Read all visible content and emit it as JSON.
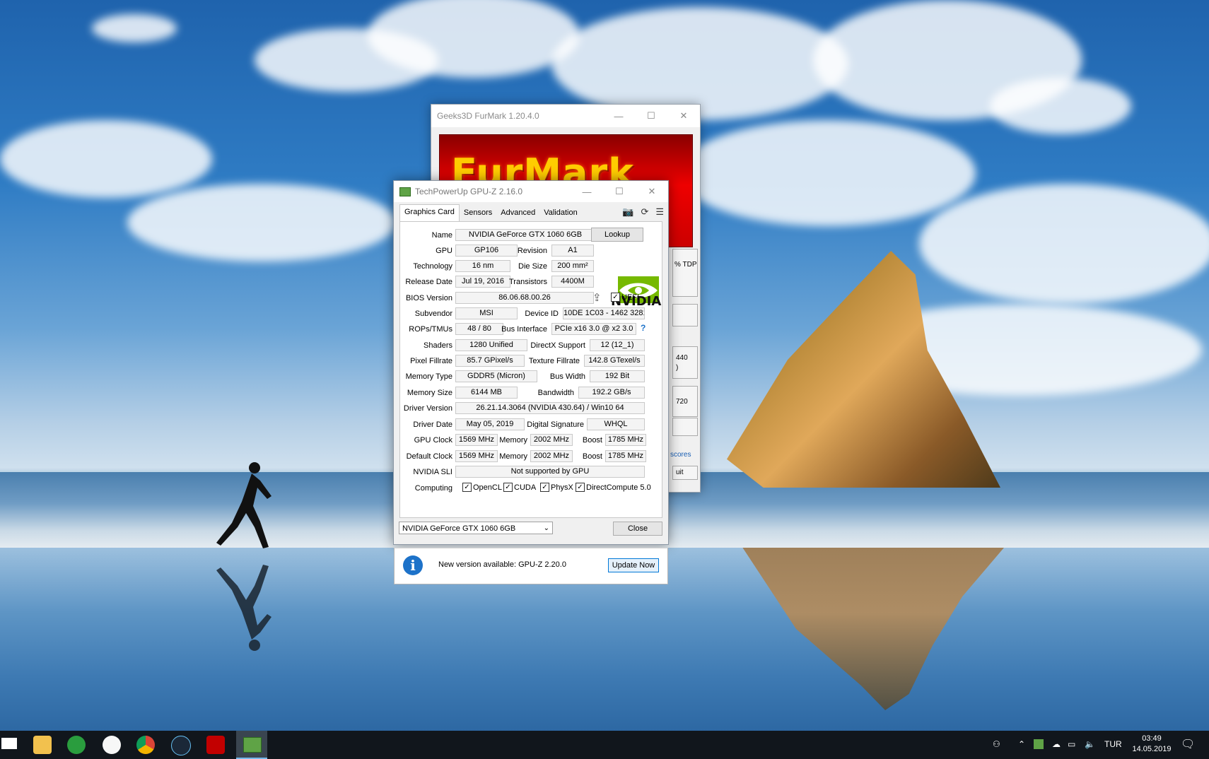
{
  "furmark": {
    "title": "Geeks3D FurMark 1.20.4.0",
    "banner": "FurMark",
    "side_texts": [
      "% TDP",
      "440",
      ")",
      "720",
      "scores",
      "uit"
    ]
  },
  "gpuz": {
    "title": "TechPowerUp GPU-Z 2.16.0",
    "tabs": [
      "Graphics Card",
      "Sensors",
      "Advanced",
      "Validation"
    ],
    "labels": {
      "name": "Name",
      "gpu": "GPU",
      "revision": "Revision",
      "technology": "Technology",
      "die_size": "Die Size",
      "release_date": "Release Date",
      "transistors": "Transistors",
      "bios_version": "BIOS Version",
      "subvendor": "Subvendor",
      "device_id": "Device ID",
      "rops_tmus": "ROPs/TMUs",
      "bus_interface": "Bus Interface",
      "shaders": "Shaders",
      "directx": "DirectX Support",
      "pixel_fillrate": "Pixel Fillrate",
      "texture_fillrate": "Texture Fillrate",
      "memory_type": "Memory Type",
      "bus_width": "Bus Width",
      "memory_size": "Memory Size",
      "bandwidth": "Bandwidth",
      "driver_version": "Driver Version",
      "driver_date": "Driver Date",
      "digital_signature": "Digital Signature",
      "gpu_clock": "GPU Clock",
      "memory": "Memory",
      "boost": "Boost",
      "default_clock": "Default Clock",
      "nvidia_sli": "NVIDIA SLI",
      "computing": "Computing"
    },
    "values": {
      "name": "NVIDIA GeForce GTX 1060 6GB",
      "gpu": "GP106",
      "revision": "A1",
      "technology": "16 nm",
      "die_size": "200 mm²",
      "release_date": "Jul 19, 2016",
      "transistors": "4400M",
      "bios_version": "86.06.68.00.26",
      "subvendor": "MSI",
      "device_id": "10DE 1C03 - 1462 3281",
      "rops_tmus": "48 / 80",
      "bus_interface": "PCIe x16 3.0 @ x2 3.0",
      "shaders": "1280 Unified",
      "directx": "12 (12_1)",
      "pixel_fillrate": "85.7 GPixel/s",
      "texture_fillrate": "142.8 GTexel/s",
      "memory_type": "GDDR5 (Micron)",
      "bus_width": "192 Bit",
      "memory_size": "6144 MB",
      "bandwidth": "192.2 GB/s",
      "driver_version": "26.21.14.3064 (NVIDIA 430.64) / Win10 64",
      "driver_date": "May 05, 2019",
      "digital_signature": "WHQL",
      "gpu_clock": "1569 MHz",
      "gpu_memory": "2002 MHz",
      "gpu_boost": "1785 MHz",
      "default_clock": "1569 MHz",
      "default_memory": "2002 MHz",
      "default_boost": "1785 MHz",
      "nvidia_sli": "Not supported by GPU"
    },
    "uefi_label": "UEFI",
    "help_mark": "?",
    "computing": [
      "OpenCL",
      "CUDA",
      "PhysX",
      "DirectCompute 5.0"
    ],
    "lookup_label": "Lookup",
    "nvidia_logo_text": "NVIDIA",
    "gpu_select": "NVIDIA GeForce GTX 1060 6GB",
    "close_label": "Close",
    "notification": "New version available: GPU-Z 2.20.0",
    "update_label": "Update Now"
  },
  "taskbar": {
    "lang": "TUR",
    "time": "03:49",
    "date": "14.05.2019"
  },
  "colors": {
    "nvidia_green": "#76b900",
    "update_blue": "#1d72c9",
    "taskbar": "#11161c"
  }
}
